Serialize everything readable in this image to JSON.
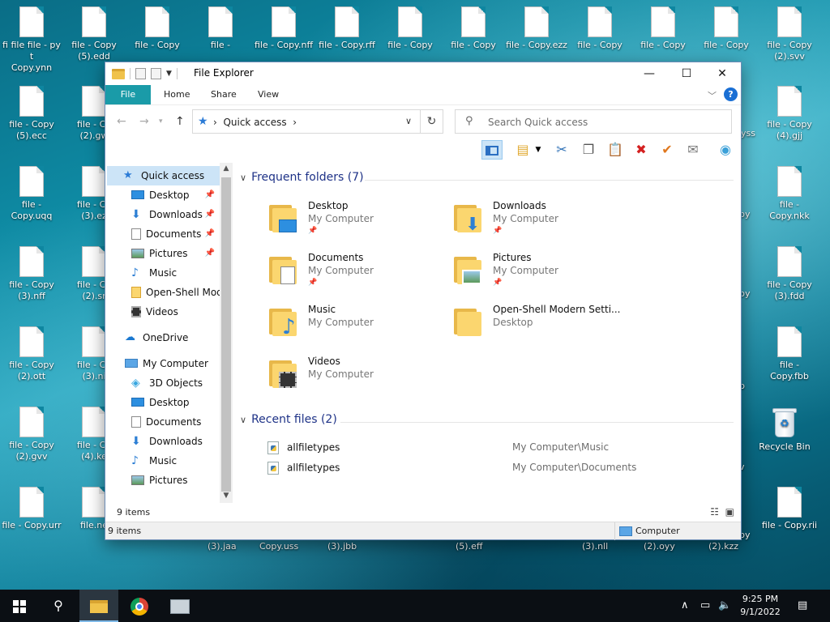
{
  "desktop": {
    "icons": [
      {
        "label": "fi file file - py t\nCopy.ynn"
      },
      {
        "label": "file - Copy\n(5).edd"
      },
      {
        "label": "file - Copy"
      },
      {
        "label": "file -"
      },
      {
        "label": "file - Copy.nff"
      },
      {
        "label": "file - Copy.rff"
      },
      {
        "label": "file - Copy"
      },
      {
        "label": "file - Copy"
      },
      {
        "label": "file - Copy.ezz"
      },
      {
        "label": "file - Copy"
      },
      {
        "label": "file - Copy"
      },
      {
        "label": "file - Copy"
      },
      {
        "label": "file - Copy\n(2).svv"
      },
      {
        "label": "file - Copy\n(5).ecc"
      },
      {
        "label": "file - Co\n(2).gw"
      },
      {
        "label": "file - Copy\n(4).gjj"
      },
      {
        "label": "file -\nCopy.uqq"
      },
      {
        "label": "file - Co\n(3).ez"
      },
      {
        "label": "file -\nCopy.nkk"
      },
      {
        "label": "file - Copy\n(3).nff"
      },
      {
        "label": "file - Co\n(2).sr"
      },
      {
        "label": "file - Copy\n(3).fdd"
      },
      {
        "label": "file - Copy\n(2).ott"
      },
      {
        "label": "file - Co\n(3).ni"
      },
      {
        "label": "file -\nCopy.fbb"
      },
      {
        "label": "file - Copy\n(2).gvv"
      },
      {
        "label": "file - Co\n(4).ke"
      },
      {
        "label": "Recycle Bin"
      },
      {
        "label": "file - Copy.urr"
      },
      {
        "label": "file.ne"
      },
      {
        "label": "file - Copy.rii"
      }
    ],
    "partial_labels": [
      "(3).jaa",
      "Copy.uss",
      "(3).jbb",
      "(5).eff",
      "(3).nll",
      "(2).oyy",
      "(2).kzz",
      "yss",
      "py",
      "py",
      "b",
      "v",
      "py"
    ]
  },
  "window": {
    "title": "File Explorer",
    "controls": {
      "minimize": "—",
      "maximize": "☐",
      "close": "✕"
    },
    "ribbon_tabs": [
      "File",
      "Home",
      "Share",
      "View"
    ],
    "help": "?",
    "address": {
      "location": "Quick access",
      "separator": "›"
    },
    "search": {
      "placeholder": "Search Quick access"
    },
    "nav": {
      "quick_access": "Quick access",
      "items": [
        {
          "label": "Desktop",
          "pinned": true
        },
        {
          "label": "Downloads",
          "pinned": true
        },
        {
          "label": "Documents",
          "pinned": true
        },
        {
          "label": "Pictures",
          "pinned": true
        },
        {
          "label": "Music",
          "pinned": false
        },
        {
          "label": "Open-Shell Mod",
          "pinned": false
        },
        {
          "label": "Videos",
          "pinned": false
        }
      ],
      "onedrive": "OneDrive",
      "my_computer": "My Computer",
      "computer_items": [
        "3D Objects",
        "Desktop",
        "Documents",
        "Downloads",
        "Music",
        "Pictures"
      ]
    },
    "frequent": {
      "header": "Frequent folders (7)",
      "folders": [
        {
          "name": "Desktop",
          "location": "My Computer",
          "pinned": true
        },
        {
          "name": "Downloads",
          "location": "My Computer",
          "pinned": true
        },
        {
          "name": "Documents",
          "location": "My Computer",
          "pinned": true
        },
        {
          "name": "Pictures",
          "location": "My Computer",
          "pinned": true
        },
        {
          "name": "Music",
          "location": "My Computer",
          "pinned": false
        },
        {
          "name": "Open-Shell Modern Setti...",
          "location": "Desktop",
          "pinned": false
        },
        {
          "name": "Videos",
          "location": "My Computer",
          "pinned": false
        }
      ]
    },
    "recent": {
      "header": "Recent files (2)",
      "files": [
        {
          "name": "allfiletypes",
          "location": "My Computer\\Music"
        },
        {
          "name": "allfiletypes",
          "location": "My Computer\\Documents"
        }
      ]
    },
    "status": {
      "items": "9 items"
    },
    "details": {
      "items": "9 items",
      "computer": "Computer"
    }
  },
  "taskbar": {
    "time": "9:25 PM",
    "date": "9/1/2022"
  },
  "colors": {
    "accent": "#1a9ba8",
    "selection": "#cce4f7",
    "header": "#1e3287"
  }
}
